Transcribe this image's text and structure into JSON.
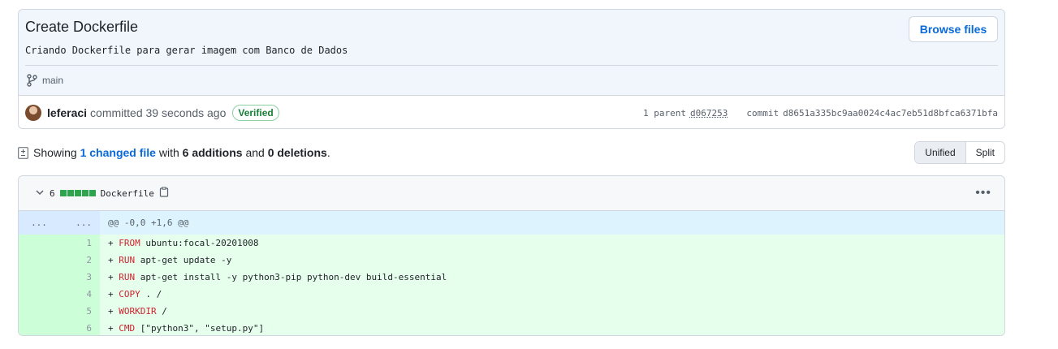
{
  "commit": {
    "title": "Create Dockerfile",
    "description": "Criando Dockerfile para gerar imagem com Banco de Dados",
    "browse_label": "Browse files",
    "branch": "main",
    "author": "leferaci",
    "committed_text": "committed 39 seconds ago",
    "verified_label": "Verified",
    "parent_label": "1 parent",
    "parent_sha": "d067253",
    "commit_label": "commit",
    "commit_sha": "d8651a335bc9aa0024c4ac7eb51d8bfca6371bfa"
  },
  "summary": {
    "showing": "Showing",
    "changed_files": "1 changed file",
    "with": "with",
    "additions": "6 additions",
    "and": "and",
    "deletions": "0 deletions",
    "period": "."
  },
  "view_toggle": {
    "unified": "Unified",
    "split": "Split"
  },
  "file": {
    "change_count": "6",
    "name": "Dockerfile",
    "hunk_left": "...",
    "hunk_right": "...",
    "hunk_header": "@@ -0,0 +1,6 @@",
    "lines": [
      {
        "num": "1",
        "kw": "FROM",
        "rest": " ubuntu:focal-20201008"
      },
      {
        "num": "2",
        "kw": "RUN",
        "rest": " apt-get update -y"
      },
      {
        "num": "3",
        "kw": "RUN",
        "rest": " apt-get install -y python3-pip python-dev build-essential"
      },
      {
        "num": "4",
        "kw": "COPY",
        "rest": " . /"
      },
      {
        "num": "5",
        "kw": "WORKDIR",
        "rest": " /"
      },
      {
        "num": "6",
        "kw": "CMD",
        "rest": " [\"python3\", \"setup.py\"]"
      }
    ],
    "plus": "+ "
  },
  "colors": {
    "accent": "#0969da",
    "added_bg": "#e6ffec",
    "added_num_bg": "#ccffd8",
    "keyword": "#cf222e",
    "verified": "#1a7f37"
  }
}
